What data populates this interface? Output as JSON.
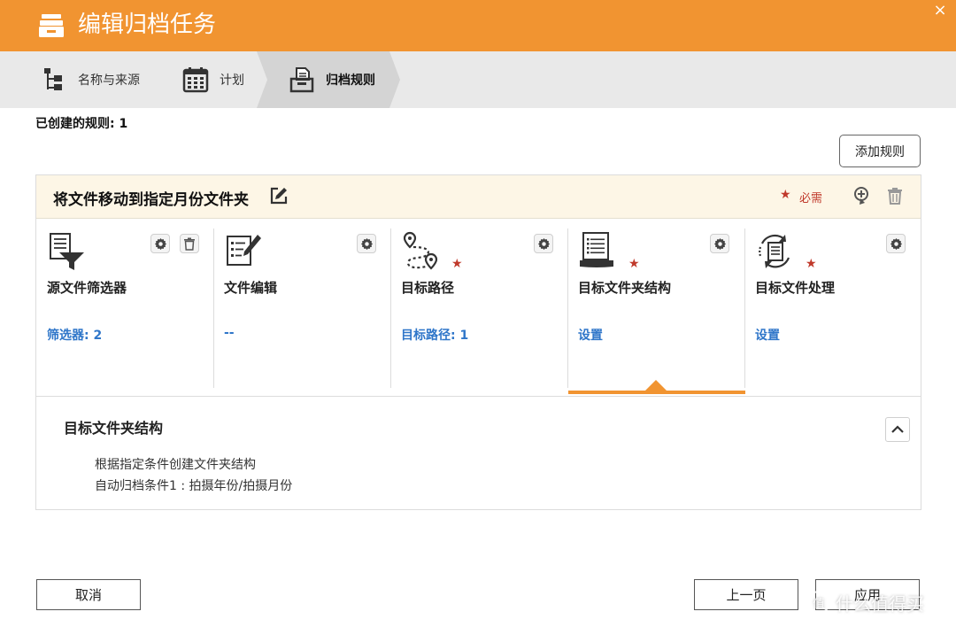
{
  "window": {
    "title": "编辑归档任务",
    "close_glyph": "×",
    "accent_color": "#f19431"
  },
  "wizard": {
    "steps": [
      {
        "label": "名称与来源",
        "icon": "tree-structure-icon",
        "active": false
      },
      {
        "label": "计划",
        "icon": "calendar-icon",
        "active": false
      },
      {
        "label": "归档规则",
        "icon": "archive-document-icon",
        "active": true
      }
    ]
  },
  "rules": {
    "created_label": "已创建的规则: 1",
    "add_rule_label": "添加规则"
  },
  "rule": {
    "title": "将文件移动到指定月份文件夹",
    "required_star": "★",
    "required_label": "必需",
    "cards": [
      {
        "title": "源文件筛选器",
        "value": "筛选器: 2",
        "icon": "file-filter-icon",
        "required": false
      },
      {
        "title": "文件编辑",
        "value": "--",
        "icon": "file-edit-icon",
        "required": false
      },
      {
        "title": "目标路径",
        "value": "目标路径: 1",
        "icon": "route-path-icon",
        "required": true
      },
      {
        "title": "目标文件夹结构",
        "value": "设置",
        "icon": "folder-structure-icon",
        "required": true,
        "active": true
      },
      {
        "title": "目标文件处理",
        "value": "设置",
        "icon": "file-process-icon",
        "required": true
      }
    ],
    "detail": {
      "title": "目标文件夹结构",
      "lines": [
        "根据指定条件创建文件夹结构",
        "自动归档条件1 : 拍摄年份/拍摄月份"
      ]
    }
  },
  "footer": {
    "cancel_label": "取消",
    "prev_label": "上一页",
    "apply_label": "应用"
  },
  "watermark": {
    "text": "什么值得买",
    "mark": "值"
  }
}
